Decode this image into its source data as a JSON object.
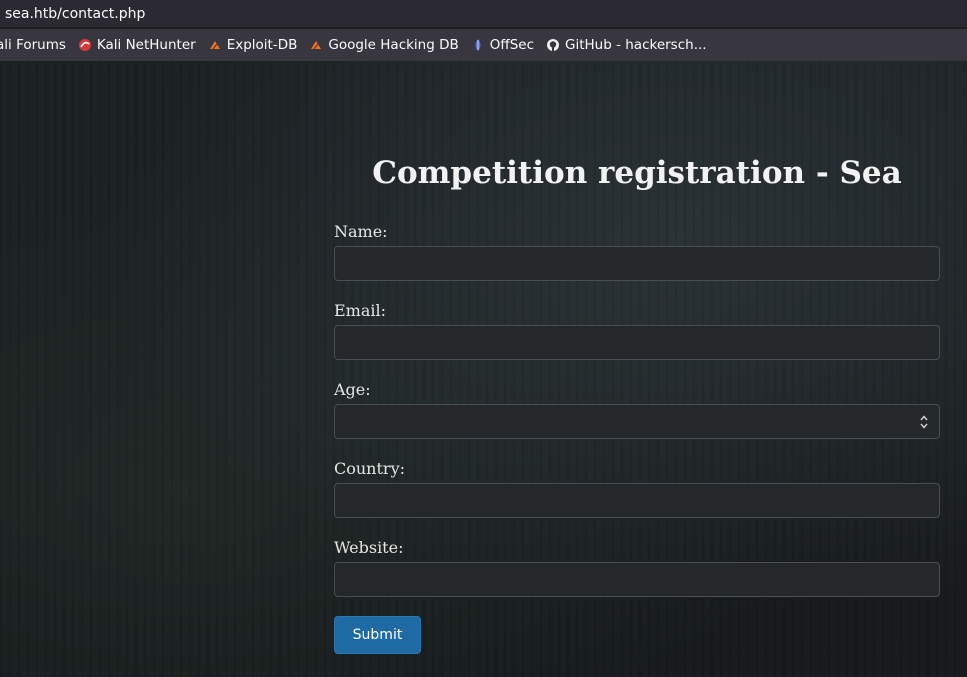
{
  "browser": {
    "url": "sea.htb/contact.php",
    "bookmarks": [
      {
        "label": "ali Forums",
        "icon": "kali-forums-icon",
        "color": "#3a6ee8"
      },
      {
        "label": "Kali NetHunter",
        "icon": "kali-nethunter-icon",
        "color": "#e03a3a"
      },
      {
        "label": "Exploit-DB",
        "icon": "exploit-db-icon",
        "color": "#e8732a"
      },
      {
        "label": "Google Hacking DB",
        "icon": "ghdb-icon",
        "color": "#e8732a"
      },
      {
        "label": "OffSec",
        "icon": "offsec-icon",
        "color": "#6a7fe0"
      },
      {
        "label": "GitHub - hackersch...",
        "icon": "github-icon",
        "color": "#ffffff"
      }
    ]
  },
  "form": {
    "title": "Competition registration - Sea",
    "name_label": "Name:",
    "email_label": "Email:",
    "age_label": "Age:",
    "country_label": "Country:",
    "website_label": "Website:",
    "submit_label": "Submit"
  },
  "colors": {
    "accent": "#1e6aa5",
    "input_bg": "#25282b",
    "page_bg": "#1a1d1e"
  }
}
